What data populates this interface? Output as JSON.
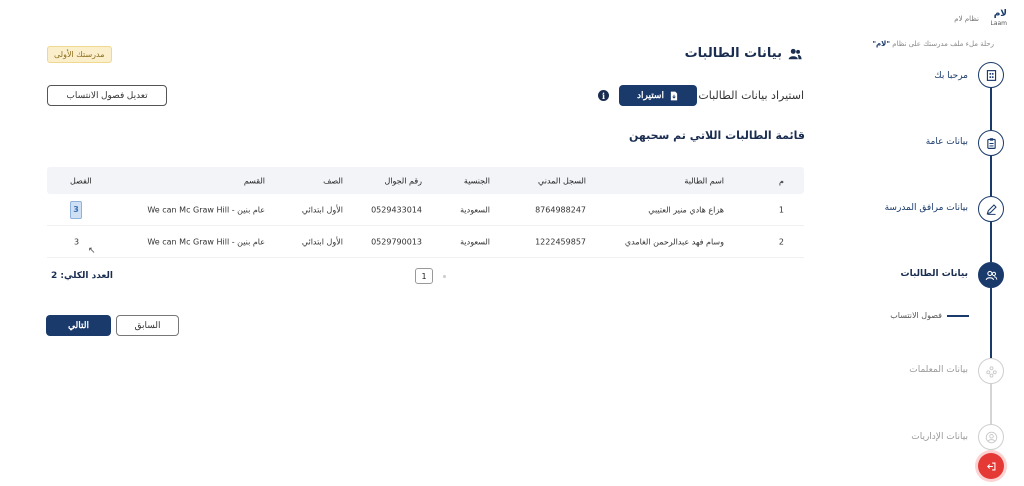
{
  "brand": {
    "logo_text": "لام",
    "logo_sub": "Laam",
    "system_label": "نظام لام"
  },
  "journey_text_prefix": "رحلة ملء ملف مدرستك على نظام",
  "journey_text_brand": "\"لام\"",
  "steps": [
    {
      "label": "مرحبا بك",
      "icon": "building-icon"
    },
    {
      "label": "بيانات عامة",
      "icon": "clipboard-icon"
    },
    {
      "label": "بيانات مرافق المدرسة",
      "icon": "pencil-icon"
    },
    {
      "label": "بيانات الطالبات",
      "icon": "users-icon"
    },
    {
      "label": "بيانات المعلمات",
      "icon": "group-icon"
    },
    {
      "label": "بيانات الإداريات",
      "icon": "user-icon"
    }
  ],
  "sub_step": "فصول الانتساب",
  "header": {
    "title": "بيانات الطالبات",
    "school_badge": "مدرستك الأولى",
    "import_label": "استيراد بيانات الطالبات",
    "import_button": "استيراد",
    "edit_button": "تعديل فصول الانتساب"
  },
  "list_title": "قائمة الطالبات اللاتي تم سحبهن",
  "table": {
    "headers": {
      "m": "م",
      "name": "اسم الطالبة",
      "civil": "السجل المدني",
      "nat": "الجنسية",
      "phone": "رقم الجوال",
      "grade": "الصف",
      "dept": "القسم",
      "class": "الفصل"
    },
    "rows": [
      {
        "m": "1",
        "name": "هزاع هادي منير العتيبي",
        "civil": "8764988247",
        "nat": "السعودية",
        "phone": "0529433014",
        "grade": "الأول ابتدائي",
        "dept": "عام بنين - We can Mc Graw Hill",
        "class": "3"
      },
      {
        "m": "2",
        "name": "وسام فهد عبدالرحمن الغامدي",
        "civil": "1222459857",
        "nat": "السعودية",
        "phone": "0529790013",
        "grade": "الأول ابتدائي",
        "dept": "عام بنين - We can Mc Graw Hill",
        "class": "3"
      }
    ]
  },
  "pagination": {
    "current_page": "1"
  },
  "total_text": "العدد الكلي: 2",
  "buttons": {
    "next": "التالي",
    "previous": "السابق"
  },
  "colors": {
    "primary": "#1a3a6b",
    "badge_bg": "#fbeecb",
    "exit": "#e53935"
  }
}
